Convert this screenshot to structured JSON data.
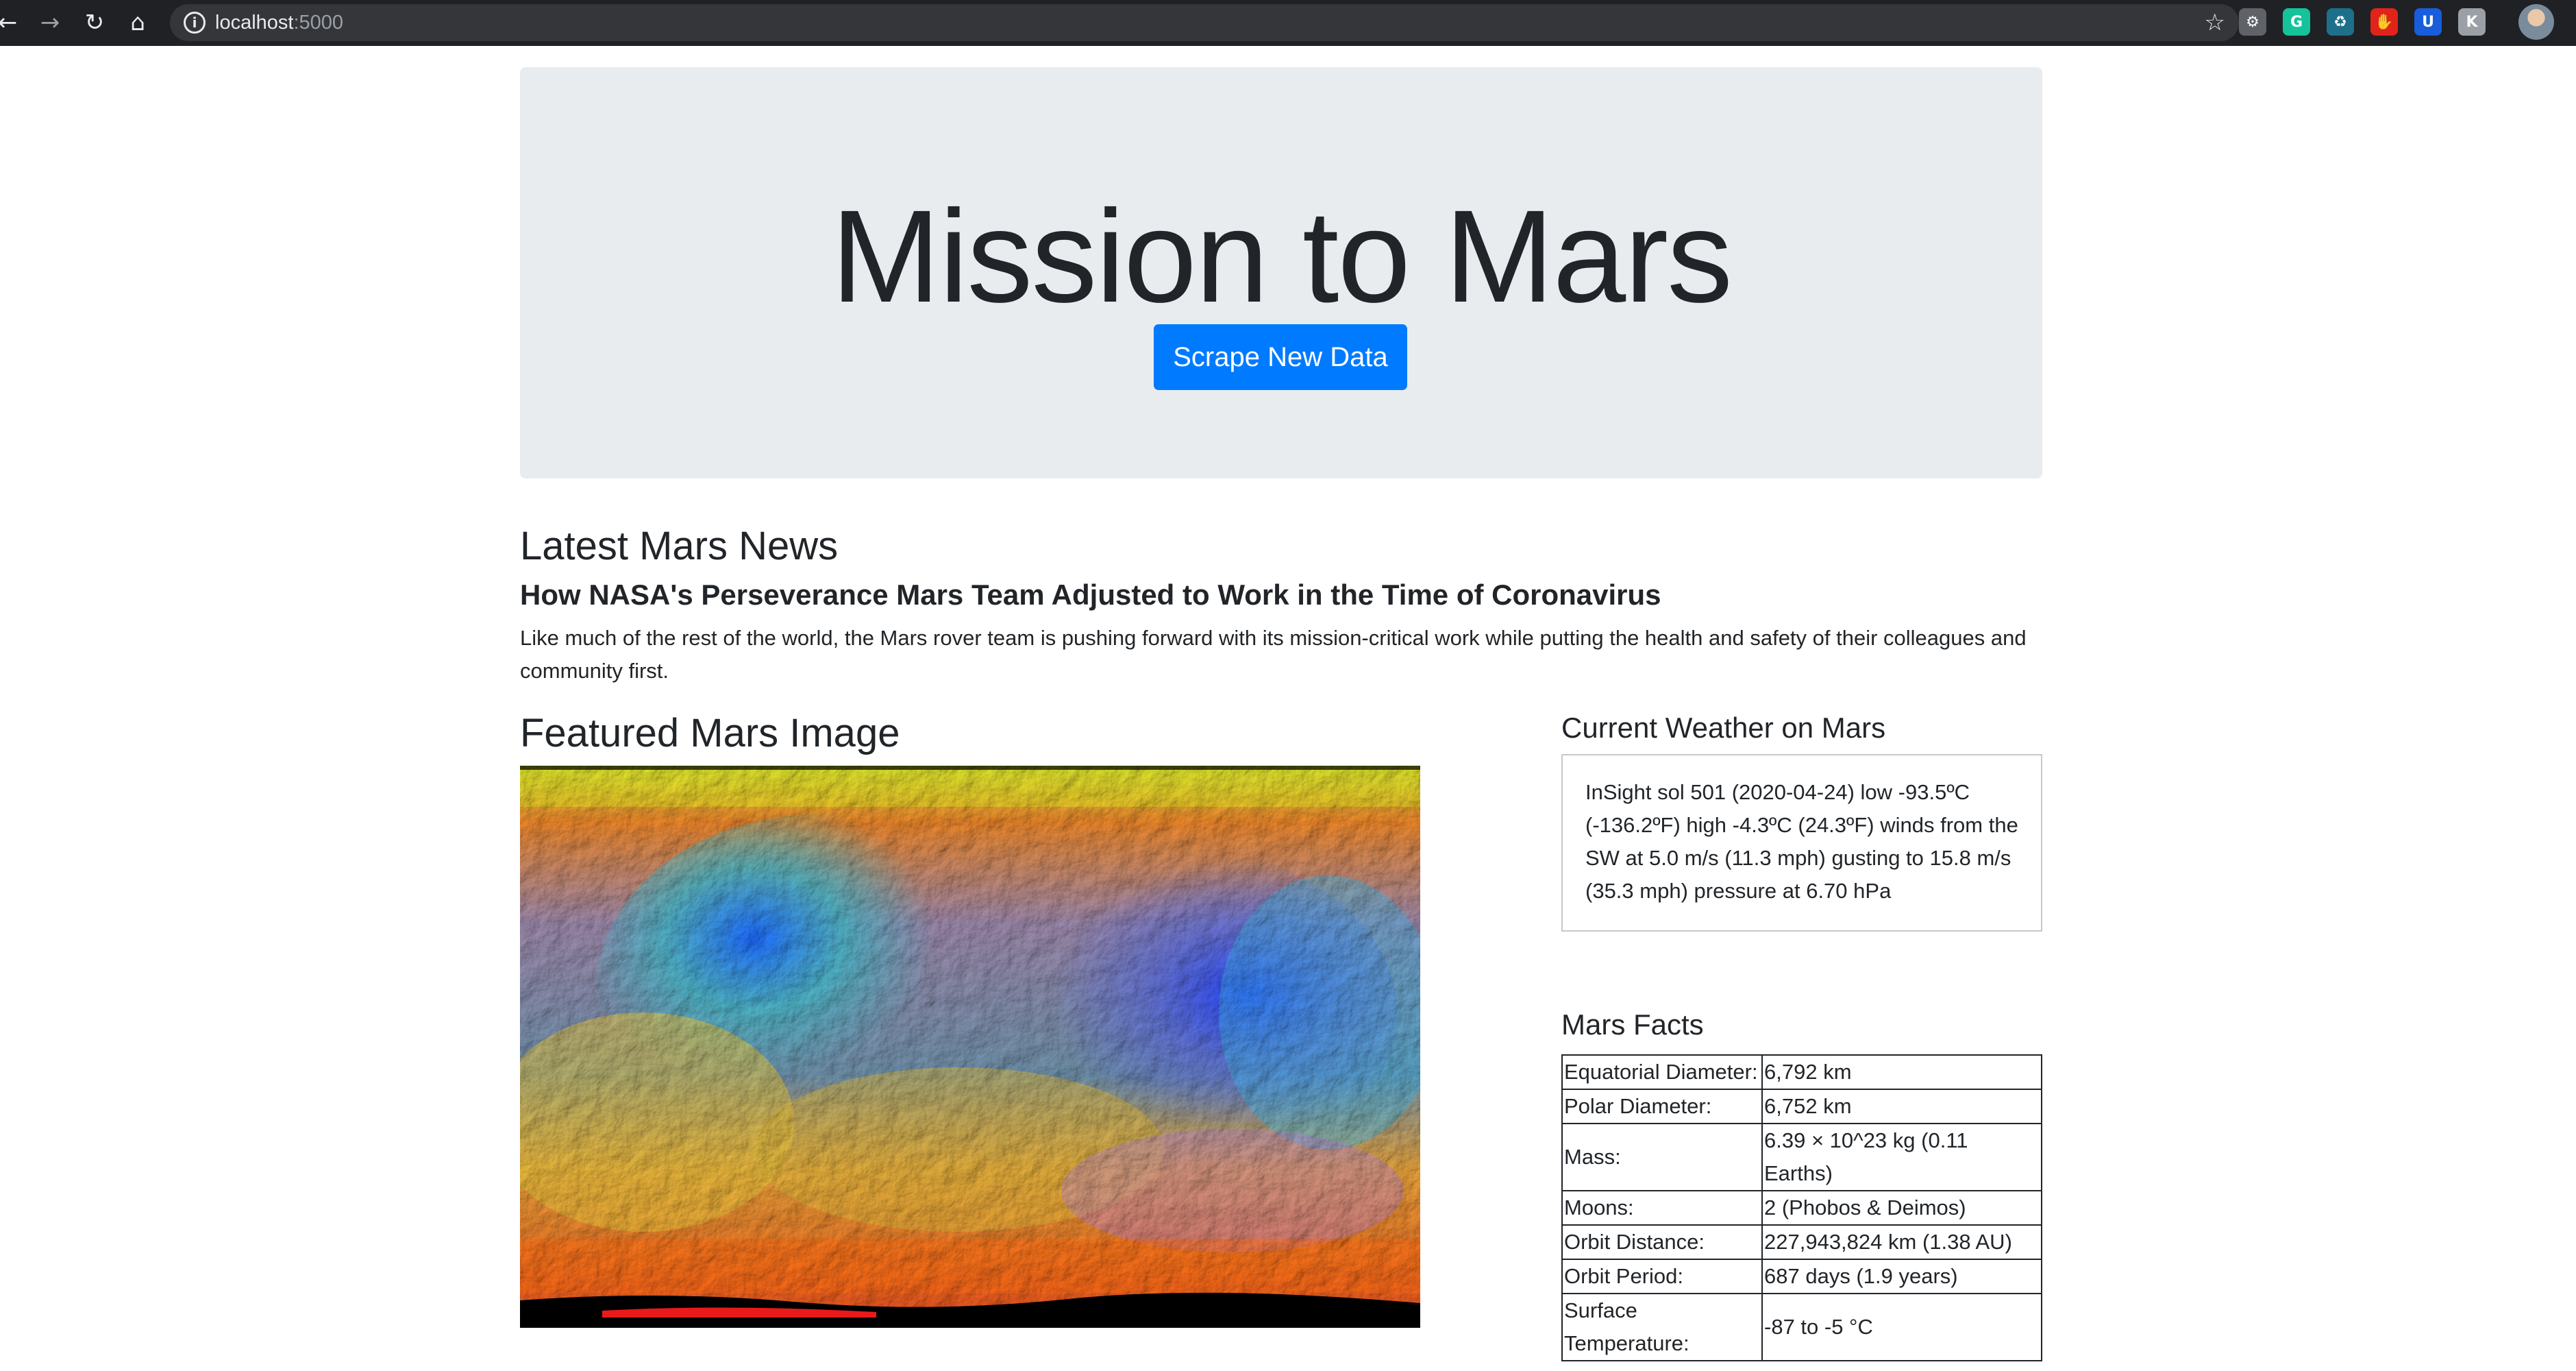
{
  "browser": {
    "url_host": "localhost",
    "url_port": ":5000",
    "extensions": [
      {
        "icon": "settings-gear-extension-icon",
        "glyph": "⚙",
        "color": "#5f6368"
      },
      {
        "icon": "grammarly-icon",
        "glyph": "G",
        "color": "#15c39a"
      },
      {
        "icon": "recycle-extension-icon",
        "glyph": "♻",
        "color": "#1e6f8a"
      },
      {
        "icon": "adblock-icon",
        "glyph": "✋",
        "color": "#e2231a"
      },
      {
        "icon": "bitwarden-icon",
        "glyph": "U",
        "color": "#175ddc"
      },
      {
        "icon": "k-extension-icon",
        "glyph": "K",
        "color": "#9aa0a6"
      }
    ]
  },
  "header": {
    "title": "Mission to Mars",
    "scrape_button": "Scrape New Data",
    "accent_color": "#007bff"
  },
  "news": {
    "section_title": "Latest Mars News",
    "headline": "How NASA's Perseverance Mars Team Adjusted to Work in the Time of Coronavirus",
    "paragraph": "Like much of the rest of the world, the Mars rover team is pushing forward with its mission-critical work while putting the health and safety of their colleagues and community first."
  },
  "featured": {
    "section_title": "Featured Mars Image"
  },
  "weather": {
    "section_title": "Current Weather on Mars",
    "text": "InSight sol 501 (2020-04-24) low -93.5ºC (-136.2ºF) high -4.3ºC (24.3ºF) winds from the SW at 5.0 m/s (11.3 mph) gusting to 15.8 m/s (35.3 mph) pressure at 6.70 hPa"
  },
  "facts": {
    "section_title": "Mars Facts",
    "rows": [
      {
        "label": "Equatorial Diameter:",
        "value": "6,792 km"
      },
      {
        "label": "Polar Diameter:",
        "value": "6,752 km"
      },
      {
        "label": "Mass:",
        "value": "6.39 × 10^23 kg (0.11 Earths)"
      },
      {
        "label": "Moons:",
        "value": "2 (Phobos & Deimos)"
      },
      {
        "label": "Orbit Distance:",
        "value": "227,943,824 km (1.38 AU)"
      },
      {
        "label": "Orbit Period:",
        "value": "687 days (1.9 years)"
      },
      {
        "label": "Surface Temperature:",
        "value": "-87 to -5 °C"
      }
    ]
  }
}
